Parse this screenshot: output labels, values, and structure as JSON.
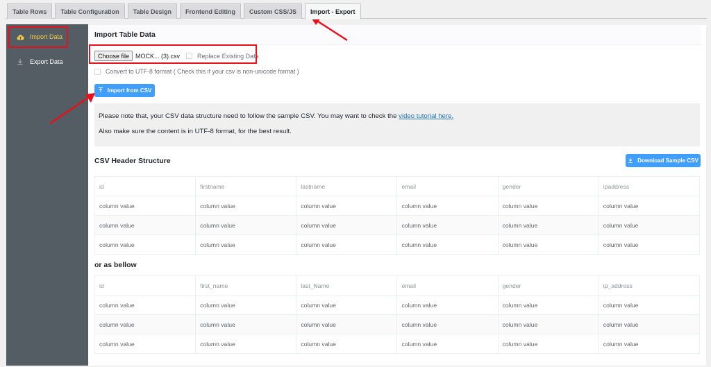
{
  "tabs": [
    {
      "label": "Table Rows",
      "active": false
    },
    {
      "label": "Table Configuration",
      "active": false
    },
    {
      "label": "Table Design",
      "active": false
    },
    {
      "label": "Frontend Editing",
      "active": false
    },
    {
      "label": "Custom CSS/JS",
      "active": false
    },
    {
      "label": "Import - Export",
      "active": true
    }
  ],
  "sidebar": {
    "items": [
      {
        "label": "Import Data",
        "icon": "cloud-upload-icon",
        "active": true
      },
      {
        "label": "Export Data",
        "icon": "download-icon",
        "active": false
      }
    ]
  },
  "import": {
    "title": "Import Table Data",
    "choose_file_label": "Choose file",
    "file_name": "MOCK... (3).csv",
    "replace_label": "Replace Existing Data",
    "replace_checked": false,
    "utf8_label": "Convert to UTF-8 format ( Check this if your csv is non-unicode format )",
    "utf8_checked": false,
    "import_button": "Import from CSV"
  },
  "notice": {
    "line1_prefix": "Please note that, your CSV data structure need to follow the sample CSV. You may want to check the ",
    "line1_link": "video tutorial here.",
    "line2": "Also make sure the content is in UTF-8 format, for the best result."
  },
  "csv_structure": {
    "title": "CSV Header Structure",
    "download_button": "Download Sample CSV",
    "headers": [
      "id",
      "firstname",
      "lastname",
      "email",
      "gender",
      "ipaddress"
    ],
    "rows": [
      [
        "column value",
        "column value",
        "column value",
        "column value",
        "column value",
        "column value"
      ],
      [
        "column value",
        "column value",
        "column value",
        "column value",
        "column value",
        "column value"
      ],
      [
        "column value",
        "column value",
        "column value",
        "column value",
        "column value",
        "column value"
      ]
    ]
  },
  "alt_structure": {
    "title": "or as bellow",
    "headers": [
      "id",
      "first_name",
      "last_Name",
      "email",
      "gender",
      "ip_address"
    ],
    "rows": [
      [
        "column value",
        "column value",
        "column value",
        "column value",
        "column value",
        "column value"
      ],
      [
        "column value",
        "column value",
        "column value",
        "column value",
        "column value",
        "column value"
      ],
      [
        "column value",
        "column value",
        "column value",
        "column value",
        "column value",
        "column value"
      ]
    ]
  },
  "colors": {
    "accent": "#409eff",
    "sidebar_bg": "#545c64",
    "sidebar_active": "#f4cb46",
    "annotation": "#e8101b"
  }
}
